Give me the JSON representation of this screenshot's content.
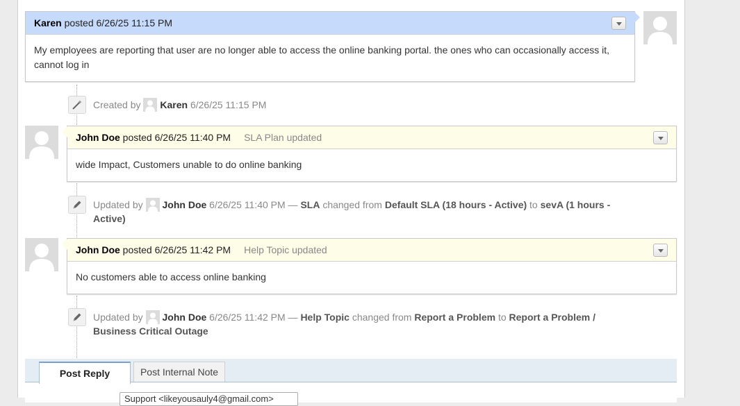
{
  "posts": [
    {
      "author": "Karen",
      "posted_word": "posted",
      "timestamp": "6/26/25 11:15 PM",
      "subtitle": "",
      "body": "My employees are reporting that user are no longer able to access the online banking portal. the ones who can occasionally access it, cannot log in"
    },
    {
      "author": "John Doe",
      "posted_word": "posted",
      "timestamp": "6/26/25 11:40 PM",
      "subtitle": "SLA Plan updated",
      "body": "wide Impact, Customers unable to do online banking"
    },
    {
      "author": "John Doe",
      "posted_word": "posted",
      "timestamp": "6/26/25 11:42 PM",
      "subtitle": "Help Topic updated",
      "body": "No customers able to access online banking"
    }
  ],
  "events": [
    {
      "icon": "magic-wand-icon",
      "action": "Created by",
      "who": "Karen",
      "timestamp": "6/26/25 11:15 PM"
    },
    {
      "icon": "pencil-icon",
      "action": "Updated by",
      "who": "John Doe",
      "timestamp": "6/26/25 11:40 PM",
      "dash": "—",
      "field": "SLA",
      "changed_from": "changed from",
      "from": "Default SLA (18 hours - Active)",
      "to_word": "to",
      "to": "sevA (1 hours - Active)"
    },
    {
      "icon": "pencil-icon",
      "action": "Updated by",
      "who": "John Doe",
      "timestamp": "6/26/25 11:42 PM",
      "dash": "—",
      "field": "Help Topic",
      "changed_from": "changed from",
      "from": "Report a Problem",
      "to_word": "to",
      "to": "Report a Problem / Business Critical Outage"
    }
  ],
  "tabs": [
    {
      "label": "Post Reply"
    },
    {
      "label": "Post Internal Note"
    }
  ],
  "reply": {
    "from_value": "Support <likeyousauly4@gmail.com>"
  },
  "colors": {
    "user_header": "#c6dafc",
    "agent_header": "#fdfde8"
  }
}
